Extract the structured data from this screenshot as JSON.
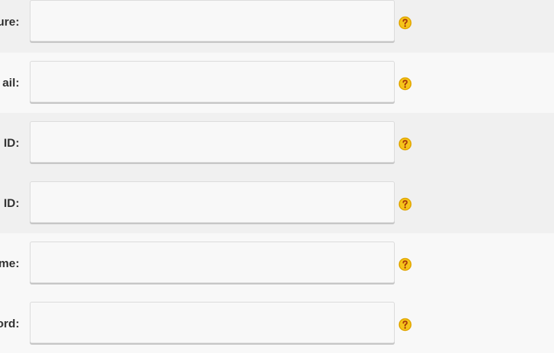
{
  "colors": {
    "band_dark": "#f0f0f0",
    "band_light": "#f8f8f8",
    "help_fill": "#f5c41a",
    "help_stroke": "#e0a400",
    "help_mark": "#a93b0a"
  },
  "form": {
    "fields": [
      {
        "label": "ure:",
        "value": "",
        "placeholder": "",
        "help_icon": "question-circle-icon"
      },
      {
        "label": "ail:",
        "value": "",
        "placeholder": "",
        "help_icon": "question-circle-icon"
      },
      {
        "label": "ID:",
        "value": "",
        "placeholder": "",
        "help_icon": "question-circle-icon"
      },
      {
        "label": "ID:",
        "value": "",
        "placeholder": "",
        "help_icon": "question-circle-icon"
      },
      {
        "label": "me:",
        "value": "",
        "placeholder": "",
        "help_icon": "question-circle-icon"
      },
      {
        "label": "ord:",
        "value": "",
        "placeholder": "",
        "help_icon": "question-circle-icon"
      }
    ]
  }
}
